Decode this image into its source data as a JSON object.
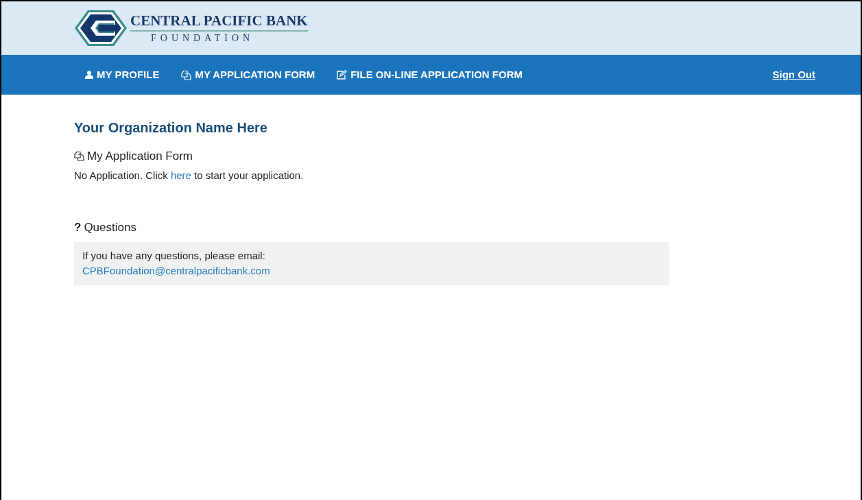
{
  "logo": {
    "line_1": "CENTRAL PACIFIC BANK",
    "line_2": "FOUNDATION"
  },
  "nav": {
    "items": [
      {
        "label": "MY PROFILE",
        "kind": "profile",
        "selected": false
      },
      {
        "label": "MY APPLICATION FORM",
        "kind": "application",
        "selected": false
      },
      {
        "label": "FILE ON-LINE APPLICATION FORM",
        "kind": "file",
        "selected": false
      }
    ],
    "sign_out": "Sign Out"
  },
  "organization_name": "Your Organization Name Here",
  "application": {
    "heading": "My Application Form",
    "text_before": "No Application. Click ",
    "link": "here",
    "text_after": " to start your application."
  },
  "questions": {
    "icon": "?",
    "heading": "Questions",
    "text": "If you have any questions, please email:",
    "email": "CPBFoundation@centralpacificbank.com"
  }
}
